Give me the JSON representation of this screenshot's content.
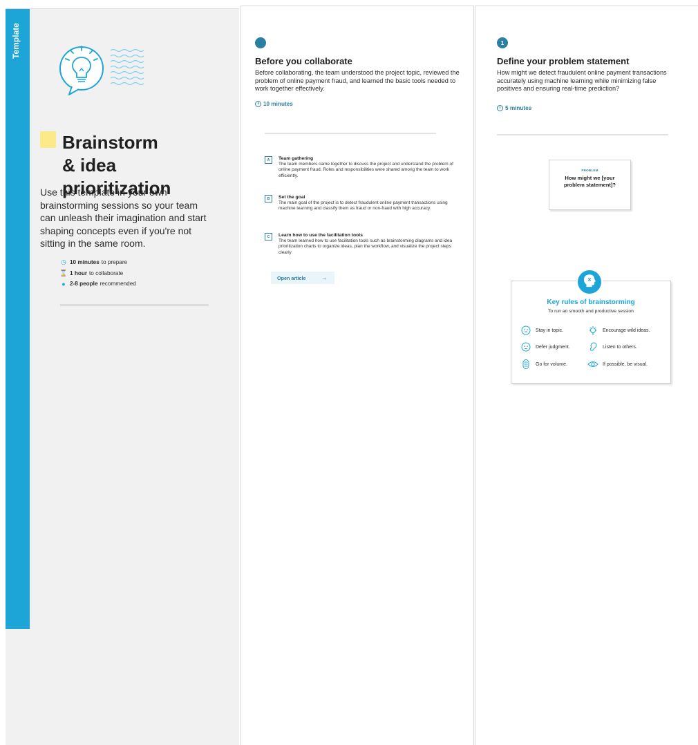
{
  "cover": {
    "tag": "Template",
    "title_line1": "Brainstorm",
    "title_line2": "& idea prioritization",
    "description": "Use this template in your own brainstorming sessions so your team can unleash their imagination and start shaping concepts even if you're not sitting in the same room.",
    "meta": [
      {
        "bold": "10 minutes",
        "text": "to prepare",
        "icon": "clock-icon"
      },
      {
        "bold": "1 hour",
        "text": "to collaborate",
        "icon": "hourglass-icon"
      },
      {
        "bold": "2-8 people",
        "text": "recommended",
        "icon": "person-icon"
      }
    ]
  },
  "before": {
    "title": "Before you collaborate",
    "body": "Before collaborating, the team understood the project topic, reviewed the problem of online payment fraud, and learned the basic tools needed to work together effectively.",
    "time": "10 minutes",
    "steps": [
      {
        "badge": "A",
        "title": "Team gathering",
        "body": "The team members came together to discuss the project and understand the problem of online payment fraud. Roles and responsibilities were shared among the team to work efficiently."
      },
      {
        "badge": "B",
        "title": "Set the goal",
        "body": "The main goal of the project is to detect fraudulent online payment transactions using machine learning and classify them as fraud or non-fraud with high accuracy."
      },
      {
        "badge": "C",
        "title": "Learn how to use the facilitation tools",
        "body": "The team learned how to use facilitation tools such as brainstorming diagrams and idea prioritization charts to organize ideas, plan the workflow, and visualize the project steps clearly"
      }
    ],
    "open_article": "Open article",
    "open_arrow": "→"
  },
  "define": {
    "step_number": "1",
    "title": "Define your problem statement",
    "body": "How might we detect fraudulent online payment transactions accurately using machine learning while minimizing false positives and ensuring real-time prediction?",
    "time": "5 minutes",
    "problem_label": "PROBLEM",
    "problem_question": "How might we [your problem statement]?",
    "rules_title": "Key rules of brainstorming",
    "rules_subtitle": "To run an smooth and productive session",
    "rules": [
      {
        "text": "Stay in topic.",
        "icon": "target-face-icon"
      },
      {
        "text": "Encourage wild ideas.",
        "icon": "lightbulb-icon"
      },
      {
        "text": "Defer judgment.",
        "icon": "neutral-face-icon"
      },
      {
        "text": "Listen to others.",
        "icon": "ear-icon"
      },
      {
        "text": "Go for volume.",
        "icon": "stack-icon"
      },
      {
        "text": "If possible, be visual.",
        "icon": "eye-icon"
      }
    ]
  },
  "colors": {
    "accent": "#1ea5d7",
    "dark_accent": "#2a7fa2",
    "sticky": "#fbe98a"
  }
}
